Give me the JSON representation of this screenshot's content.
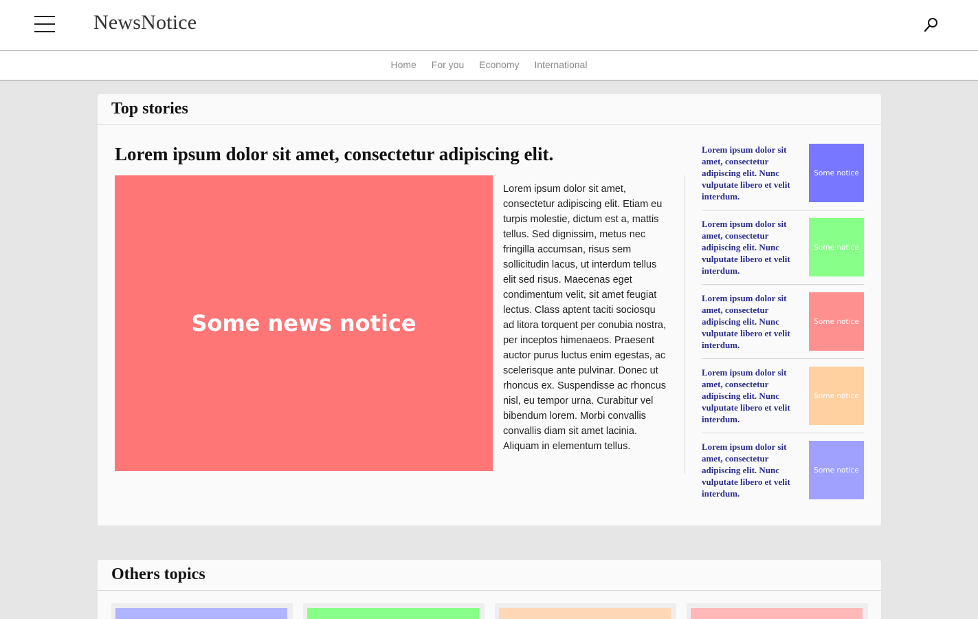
{
  "header": {
    "logo": "NewsNotice",
    "menu_icon": "hamburger-menu-icon",
    "search_icon": "search-icon"
  },
  "nav": {
    "items": [
      "Home",
      "For you",
      "Economy",
      "International"
    ]
  },
  "top_stories": {
    "title": "Top stories",
    "headline": "Lorem ipsum dolor sit amet, consectetur adipiscing elit.",
    "hero_image_label": "Some news notice",
    "hero_image_color": "#ff7676",
    "body": "Lorem ipsum dolor sit amet, consectetur adipiscing elit. Etiam eu turpis molestie, dictum est a, mattis tellus. Sed dignissim, metus nec fringilla accumsan, risus sem sollicitudin lacus, ut interdum tellus elit sed risus. Maecenas eget condimentum velit, sit amet feugiat lectus. Class aptent taciti sociosqu ad litora torquent per conubia nostra, per inceptos himenaeos. Praesent auctor purus luctus enim egestas, ac scelerisque ante pulvinar. Donec ut rhoncus ex. Suspendisse ac rhoncus nisl, eu tempor urna. Curabitur vel bibendum lorem. Morbi convallis convallis diam sit amet lacinia. Aliquam in elementum tellus.",
    "side_items": [
      {
        "text": "Lorem ipsum dolor sit amet, consectetur adipiscing elit. Nunc vulputate libero et velit interdum.",
        "thumb_label": "Some notice",
        "color": "#7777ff"
      },
      {
        "text": "Lorem ipsum dolor sit amet, consectetur adipiscing elit. Nunc vulputate libero et velit interdum.",
        "thumb_label": "Some notice",
        "color": "#88ff88"
      },
      {
        "text": "Lorem ipsum dolor sit amet, consectetur adipiscing elit. Nunc vulputate libero et velit interdum.",
        "thumb_label": "Some notice",
        "color": "#ff9090"
      },
      {
        "text": "Lorem ipsum dolor sit amet, consectetur adipiscing elit. Nunc vulputate libero et velit interdum.",
        "thumb_label": "Some notice",
        "color": "#ffd0a0"
      },
      {
        "text": "Lorem ipsum dolor sit amet, consectetur adipiscing elit. Nunc vulputate libero et velit interdum.",
        "thumb_label": "Some notice",
        "color": "#a0a0ff"
      }
    ]
  },
  "others_topics": {
    "title": "Others topics",
    "tiles": [
      {
        "color": "#b0b4ff"
      },
      {
        "color": "#88ff88"
      },
      {
        "color": "#ffd8b8"
      },
      {
        "color": "#ffb8b8"
      }
    ]
  }
}
